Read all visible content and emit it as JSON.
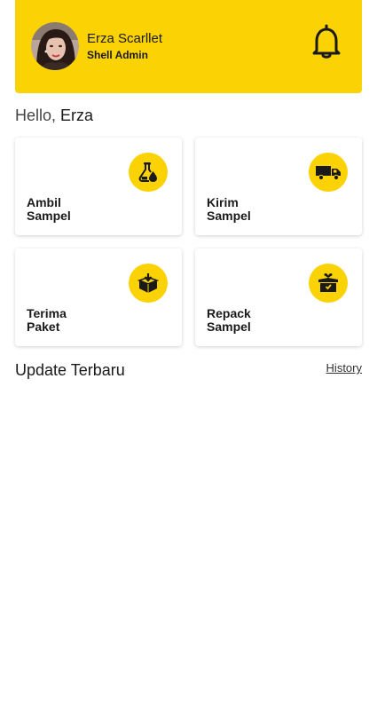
{
  "header": {
    "user_name": "Erza Scarllet",
    "user_role": "Shell Admin",
    "avatar_icon": "avatar",
    "notification_icon": "bell-icon"
  },
  "greeting": {
    "prefix": "Hello,",
    "name": "Erza"
  },
  "menu": [
    {
      "label": "Ambil\nSampel",
      "icon": "flask-drop-icon"
    },
    {
      "label": "Kirim\nSampel",
      "icon": "truck-icon"
    },
    {
      "label": "Terima\nPaket",
      "icon": "box-receive-icon"
    },
    {
      "label": "Repack\nSampel",
      "icon": "box-repack-icon"
    }
  ],
  "updates": {
    "title": "Update Terbaru",
    "history_label": "History"
  },
  "colors": {
    "accent": "#FBD203",
    "text": "#1a1a1a"
  }
}
